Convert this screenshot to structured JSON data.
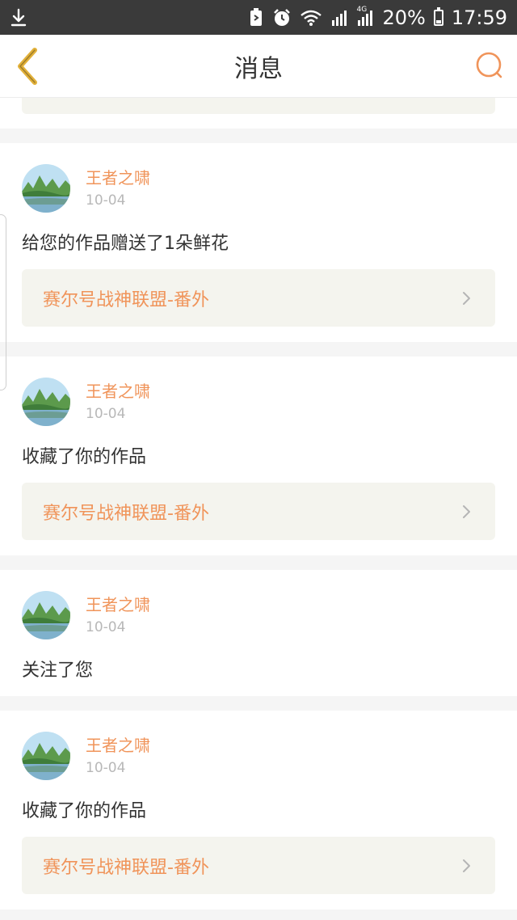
{
  "status_bar": {
    "battery_percent": "20%",
    "time": "17:59",
    "network_label": "4G",
    "icons": [
      "download-icon",
      "vibrate-icon",
      "alarm-icon",
      "wifi-icon",
      "signal-icon",
      "signal-4g-icon",
      "battery-icon"
    ]
  },
  "header": {
    "title": "消息",
    "back_icon": "chevron-left-icon",
    "search_icon": "search-icon"
  },
  "colors": {
    "accent": "#f0945a",
    "back_arrow": "#e2b13a",
    "card_link_bg": "#f4f4ee"
  },
  "messages": [
    {
      "user": "王者之啸",
      "date": "10-04",
      "text": "给您的作品赠送了1朵鲜花",
      "work_title": "赛尔号战神联盟-番外"
    },
    {
      "user": "王者之啸",
      "date": "10-04",
      "text": "收藏了你的作品",
      "work_title": "赛尔号战神联盟-番外"
    },
    {
      "user": "王者之啸",
      "date": "10-04",
      "text": "关注了您"
    },
    {
      "user": "王者之啸",
      "date": "10-04",
      "text": "收藏了你的作品",
      "work_title": "赛尔号战神联盟-番外"
    }
  ]
}
